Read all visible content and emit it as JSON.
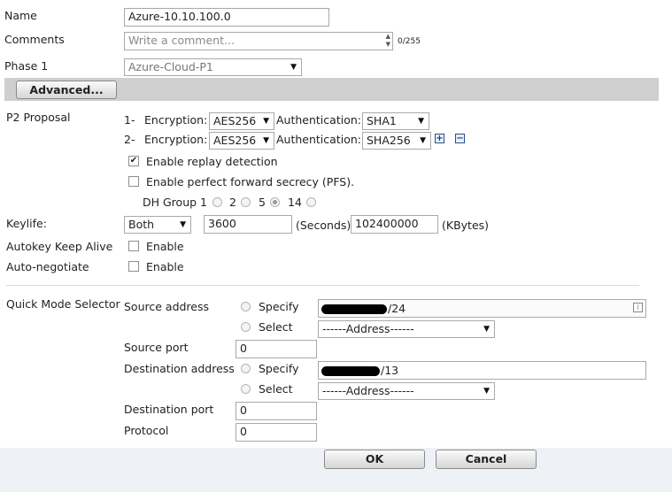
{
  "name": {
    "label": "Name",
    "value": "Azure-10.10.100.0"
  },
  "comments": {
    "label": "Comments",
    "placeholder": "Write a comment...",
    "counter": "0/255"
  },
  "phase1": {
    "label": "Phase 1",
    "value": "Azure-Cloud-P1"
  },
  "advanced_button": "Advanced...",
  "p2": {
    "label": "P2 Proposal",
    "rows": [
      {
        "index": "1-",
        "encryption_label": "Encryption:",
        "encryption": "AES256",
        "auth_label": "Authentication:",
        "auth": "SHA1"
      },
      {
        "index": "2-",
        "encryption_label": "Encryption:",
        "encryption": "AES256",
        "auth_label": "Authentication:",
        "auth": "SHA256"
      }
    ],
    "replay_label": "Enable replay detection",
    "replay_checked": true,
    "pfs_label": "Enable perfect forward secrecy (PFS).",
    "pfs_checked": false,
    "dh_label": "DH Group",
    "dh_options": [
      "1",
      "2",
      "5",
      "14"
    ],
    "dh_selected": "5"
  },
  "keylife": {
    "label": "Keylife:",
    "type": "Both",
    "seconds": "3600",
    "seconds_unit": "(Seconds)",
    "kbytes": "102400000",
    "kbytes_unit": "(KBytes)"
  },
  "autokey": {
    "label": "Autokey Keep Alive",
    "option": "Enable"
  },
  "autonegotiate": {
    "label": "Auto-negotiate",
    "option": "Enable"
  },
  "qms": {
    "label": "Quick Mode Selector",
    "source_address_label": "Source address",
    "specify_label": "Specify",
    "select_label": "Select",
    "source_address_suffix": "/24",
    "source_select": "------Address------",
    "source_port_label": "Source port",
    "source_port": "0",
    "dest_address_label": "Destination address",
    "dest_address_suffix": "/13",
    "dest_select": "------Address------",
    "dest_port_label": "Destination port",
    "dest_port": "0",
    "protocol_label": "Protocol",
    "protocol": "0"
  },
  "ok_button": "OK",
  "cancel_button": "Cancel"
}
